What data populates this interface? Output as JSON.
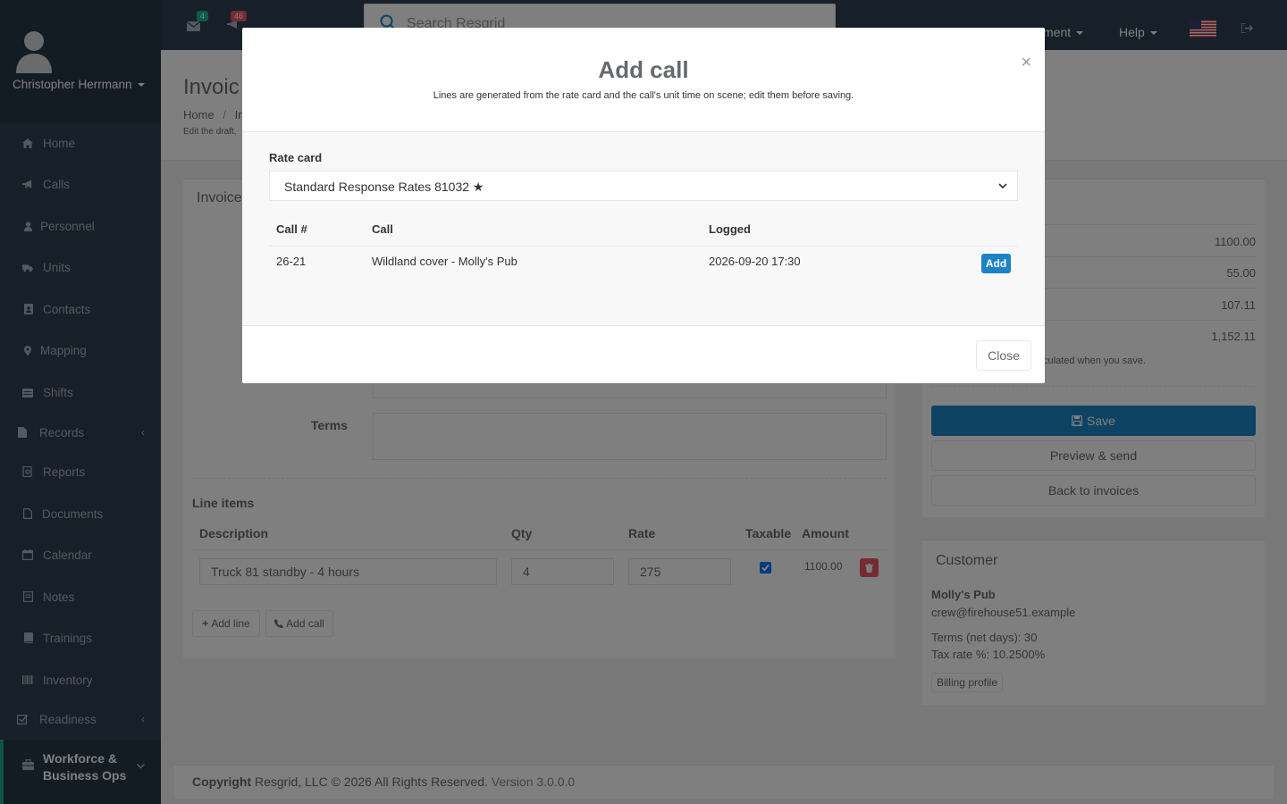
{
  "app": {
    "name": "Resgrid"
  },
  "sidebar": {
    "user_name": "Christopher Herrmann",
    "items": [
      {
        "label": "Home",
        "icon": "home-icon"
      },
      {
        "label": "Calls",
        "icon": "bullhorn-icon"
      },
      {
        "label": "Personnel",
        "icon": "user-icon"
      },
      {
        "label": "Units",
        "icon": "truck-icon"
      },
      {
        "label": "Contacts",
        "icon": "address-book-icon"
      },
      {
        "label": "Mapping",
        "icon": "map-marker-icon"
      },
      {
        "label": "Shifts",
        "icon": "shifts-icon"
      },
      {
        "label": "Records",
        "icon": "file-icon"
      },
      {
        "label": "Reports",
        "icon": "reports-icon"
      },
      {
        "label": "Documents",
        "icon": "documents-icon"
      },
      {
        "label": "Calendar",
        "icon": "calendar-icon"
      },
      {
        "label": "Notes",
        "icon": "notes-icon"
      },
      {
        "label": "Trainings",
        "icon": "book-icon"
      },
      {
        "label": "Inventory",
        "icon": "barcode-icon"
      },
      {
        "label": "Readiness",
        "icon": "check-square-icon"
      }
    ],
    "active_item": {
      "label": "Workforce & Business Ops",
      "line1": "Workforce &",
      "line2": "Business Ops",
      "icon": "briefcase-icon"
    }
  },
  "topbar": {
    "mail_count": "4",
    "notification_count": "46",
    "search_placeholder": "Search Resgrid",
    "menu_partial": "ment",
    "help_label": "Help",
    "flag": "us-flag-icon",
    "colors": {
      "mail_badge": "#1ab394",
      "notification_badge": "#ed5565",
      "nav_bg": "#2f4050"
    }
  },
  "page": {
    "title": "Invoic",
    "breadcrumb_home": "Home",
    "breadcrumb_sep": "/",
    "breadcrumb_current": "In",
    "subtitle": "Edit the draft,"
  },
  "invoice_panel": {
    "title": "Invoice",
    "terms_label": "Terms",
    "line_items_title": "Line items",
    "headers": {
      "description": "Description",
      "qty": "Qty",
      "rate": "Rate",
      "taxable": "Taxable",
      "amount": "Amount"
    },
    "line_items": [
      {
        "description": "Truck 81 standby - 4 hours",
        "qty": "4",
        "rate": "275",
        "taxable": true,
        "amount": "1100.00"
      }
    ],
    "add_line_label": "Add line",
    "add_call_label": "Add call"
  },
  "summary": {
    "values": [
      "1100.00",
      "55.00",
      "107.11",
      "1,152.11"
    ],
    "note": "culated when you save.",
    "save_label": "Save",
    "preview_label": "Preview & send",
    "back_label": "Back to invoices",
    "colors": {
      "save": "#1c84c6"
    }
  },
  "customer": {
    "title": "Customer",
    "name": "Molly's Pub",
    "email": "crew@firehouse51.example",
    "terms": "Terms (net days): 30",
    "tax_rate": "Tax rate %: 10.2500%",
    "billing_profile_label": "Billing profile"
  },
  "footer": {
    "copyright_bold": "Copyright",
    "copyright_text": "Resgrid, LLC © 2026 All Rights Reserved.",
    "version": "Version 3.0.0.0"
  },
  "modal": {
    "title": "Add call",
    "subtitle": "Lines are generated from the rate card and the call's unit time on scene; edit them before saving.",
    "close_x": "×",
    "rate_card_label": "Rate card",
    "rate_card_value": "Standard Response Rates 81032 ★",
    "columns": {
      "call_no": "Call #",
      "call": "Call",
      "logged": "Logged"
    },
    "rows": [
      {
        "call_no": "26-21",
        "call": "Wildland cover - Molly's Pub",
        "logged": "2026-09-20 17:30",
        "action": "Add"
      }
    ],
    "close_label": "Close",
    "colors": {
      "add_button": "#1c84c6"
    }
  }
}
